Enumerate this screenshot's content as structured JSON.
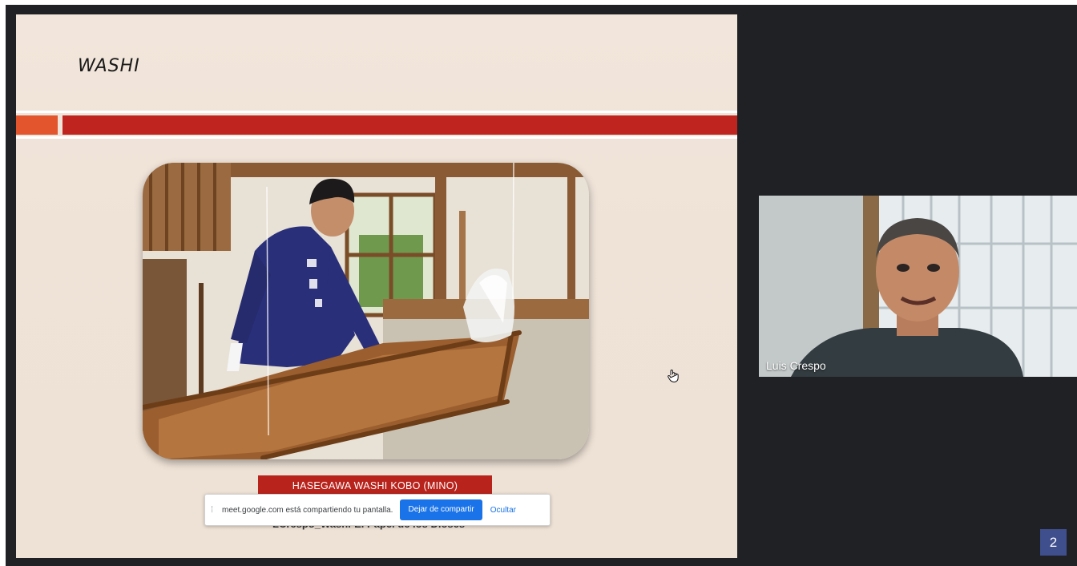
{
  "slide": {
    "title": "WASHI",
    "caption": "HASEGAWA WASHI KOBO  (MINO)",
    "author": "LCrespo_Washi-El Papel de los Dioses",
    "accent_colors": {
      "red": "#c0241e",
      "orange": "#e2552d",
      "background": "#efe3d8"
    }
  },
  "share_banner": {
    "grip_icon": "drag-handle-icon",
    "message": "meet.google.com está compartiendo tu pantalla.",
    "stop_button": "Dejar de compartir",
    "hide_link": "Ocultar"
  },
  "cursor": {
    "icon": "hand-pointer-icon"
  },
  "participant": {
    "name": "Luis Crespo"
  },
  "page_indicator": {
    "value": "2"
  }
}
